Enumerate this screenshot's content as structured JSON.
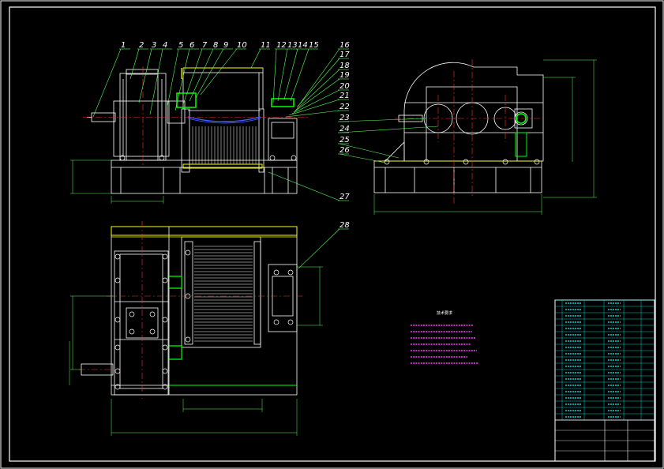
{
  "drawing": {
    "background": "#000000",
    "colors": {
      "frame": "#ffffff",
      "outline": "#ffffff",
      "center_line": "#ff3030",
      "dimension": "#5cff5c",
      "leader": "#5cff5c",
      "hatch": "#ffff00",
      "highlight": "#00ff00",
      "notes": "#ff40ff",
      "table": "#00ffff",
      "blue": "#4060ff"
    },
    "part_labels": [
      "1",
      "2",
      "3",
      "4",
      "5",
      "6",
      "7",
      "8",
      "9",
      "10",
      "11",
      "12",
      "13",
      "14",
      "15",
      "16",
      "17",
      "18",
      "19",
      "20",
      "21",
      "22",
      "23",
      "24",
      "25",
      "26",
      "27",
      "28"
    ],
    "notes_title": "技术要求",
    "title_block_name": "",
    "drawing_number": ""
  }
}
